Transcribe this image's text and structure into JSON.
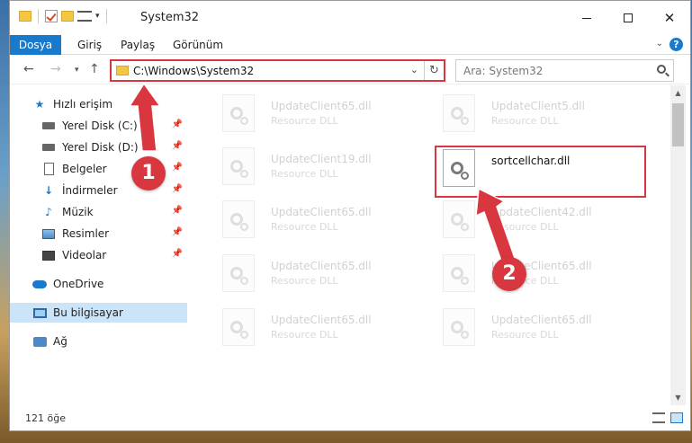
{
  "window": {
    "title": "System32",
    "controls": {
      "minimize": "",
      "maximize": "",
      "close": "✕"
    }
  },
  "ribbon": {
    "tabs": [
      "Dosya",
      "Giriş",
      "Paylaş",
      "Görünüm"
    ],
    "help": "?"
  },
  "nav": {
    "address": "C:\\Windows\\System32",
    "search_placeholder": "Ara: System32"
  },
  "sidebar": {
    "items": [
      {
        "label": "Hızlı erişim",
        "icon": "star-icon"
      },
      {
        "label": "Yerel Disk (C:)",
        "icon": "disk-icon",
        "pinned": true
      },
      {
        "label": "Yerel Disk (D:)",
        "icon": "disk-icon",
        "pinned": true
      },
      {
        "label": "Belgeler",
        "icon": "documents-icon",
        "pinned": true
      },
      {
        "label": "İndirmeler",
        "icon": "downloads-icon",
        "pinned": true
      },
      {
        "label": "Müzik",
        "icon": "music-icon",
        "pinned": true
      },
      {
        "label": "Resimler",
        "icon": "pictures-icon",
        "pinned": true
      },
      {
        "label": "Videolar",
        "icon": "videos-icon",
        "pinned": true
      },
      {
        "label": "OneDrive",
        "icon": "cloud-icon"
      },
      {
        "label": "Bu bilgisayar",
        "icon": "computer-icon",
        "selected": true
      },
      {
        "label": "Ağ",
        "icon": "network-icon"
      }
    ]
  },
  "files": [
    {
      "name": "UpdateClient65.dll",
      "type": "Resource DLL"
    },
    {
      "name": "UpdateClient5.dll",
      "type": "Resource DLL"
    },
    {
      "name": "UpdateClient19.dll",
      "type": "Resource DLL"
    },
    {
      "name": "sortcellchar.dll",
      "type": ""
    },
    {
      "name": "UpdateClient65.dll",
      "type": "Resource DLL"
    },
    {
      "name": "UpdateClient42.dll",
      "type": "Resource DLL"
    },
    {
      "name": "UpdateClient65.dll",
      "type": "Resource DLL"
    },
    {
      "name": "UpdateClient65.dll",
      "type": "Resource DLL"
    },
    {
      "name": "UpdateClient65.dll",
      "type": "Resource DLL"
    },
    {
      "name": "UpdateClient65.dll",
      "type": "Resource DLL"
    }
  ],
  "status": {
    "item_count": "121 öğe"
  },
  "annotations": {
    "step1": "1",
    "step2": "2",
    "color": "#d9373f"
  }
}
